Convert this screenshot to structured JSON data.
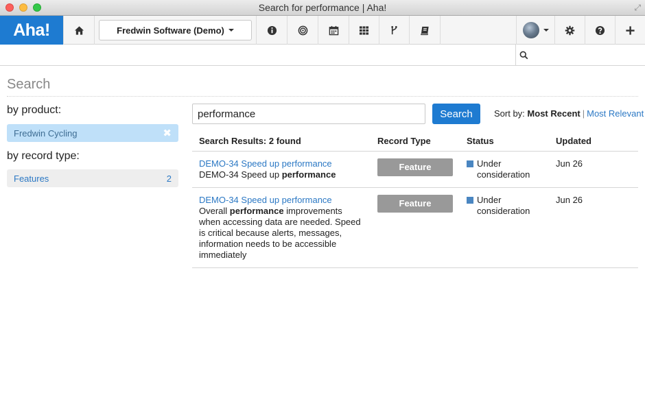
{
  "window": {
    "title": "Search for performance | Aha!"
  },
  "nav": {
    "logo": "Aha!",
    "product": "Fredwin Software (Demo)",
    "icons_left": [
      "home-icon",
      "info-icon",
      "target-icon",
      "calendar-icon",
      "grid-icon",
      "branch-icon",
      "book-icon"
    ],
    "icons_right": [
      "avatar",
      "gear-icon",
      "help-icon",
      "plus-icon"
    ]
  },
  "page": {
    "title": "Search"
  },
  "sidebar": {
    "by_product_label": "by product:",
    "product_filter": "Fredwin Cycling",
    "by_type_label": "by record type:",
    "type_filter": {
      "label": "Features",
      "count": "2"
    }
  },
  "search": {
    "query": "performance",
    "button": "Search",
    "sort_label": "Sort by:",
    "sort_active": "Most Recent",
    "sort_separator": "|",
    "sort_alt": "Most Relevant"
  },
  "results": {
    "header": "Search Results: 2 found",
    "columns": [
      "Record Type",
      "Status",
      "Updated"
    ],
    "status_color": "#4a86c1",
    "badge_color": "#999999",
    "rows": [
      {
        "link": "DEMO-34 Speed up performance",
        "snippet_pre": "DEMO-34 Speed up ",
        "snippet_bold": "performance",
        "snippet_post": "",
        "type": "Feature",
        "status_line1": "Under",
        "status_line2": "consideration",
        "updated": "Jun 26"
      },
      {
        "link": "DEMO-34 Speed up performance",
        "snippet_pre": "Overall ",
        "snippet_bold": "performance",
        "snippet_post": " improvements when accessing data are needed. Speed is critical because alerts, messages, information needs to be accessible immediately",
        "type": "Feature",
        "status_line1": "Under",
        "status_line2": "consideration",
        "updated": "Jun 26"
      }
    ]
  }
}
